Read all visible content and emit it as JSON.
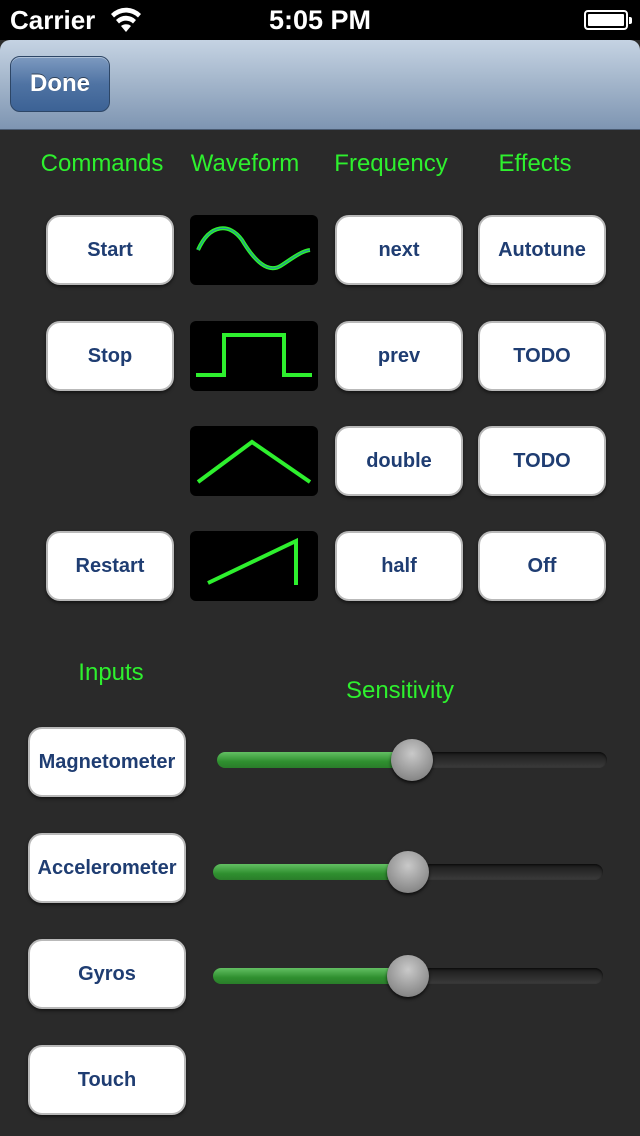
{
  "status_bar": {
    "carrier": "Carrier",
    "time": "5:05 PM",
    "wifi_icon": "wifi-icon",
    "battery_icon": "battery-icon"
  },
  "nav": {
    "done_label": "Done"
  },
  "headers": {
    "commands": "Commands",
    "waveform": "Waveform",
    "frequency": "Frequency",
    "effects": "Effects"
  },
  "commands": {
    "start": "Start",
    "stop": "Stop",
    "restart": "Restart"
  },
  "waveforms": {
    "sine": "sine-wave-icon",
    "square": "square-wave-icon",
    "triangle": "triangle-wave-icon",
    "sawtooth": "sawtooth-wave-icon"
  },
  "frequency": {
    "next": "next",
    "prev": "prev",
    "double": "double",
    "half": "half"
  },
  "effects": {
    "autotune": "Autotune",
    "todo1": "TODO",
    "todo2": "TODO",
    "off": "Off"
  },
  "inputs": {
    "label": "Inputs",
    "magnetometer": "Magnetometer",
    "accelerometer": "Accelerometer",
    "gyros": "Gyros",
    "touch": "Touch"
  },
  "sensitivity": {
    "label": "Sensitivity",
    "magnetometer_level": 0.5,
    "accelerometer_level": 0.5,
    "gyros_level": 0.5
  },
  "colors": {
    "accent_green": "#2ef02e",
    "wave_green": "#2ef02e",
    "button_text": "#1f3d72"
  }
}
